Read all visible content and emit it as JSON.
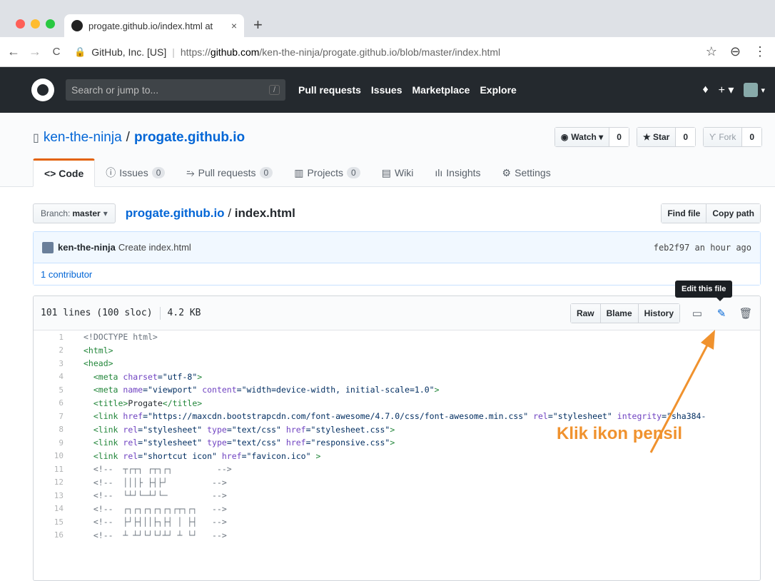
{
  "browser": {
    "tab_title": "progate.github.io/index.html at",
    "tab_close": "×",
    "new_tab": "+",
    "back": "←",
    "forward": "→",
    "reload": "C",
    "site_identity": "GitHub, Inc. [US]",
    "url_scheme": "https://",
    "url_host": "github.com",
    "url_path": "/ken-the-ninja/progate.github.io/blob/master/index.html",
    "star_icon": "☆",
    "profile_icon": "⊖",
    "menu_icon": "⋮"
  },
  "github_header": {
    "search_placeholder": "Search or jump to...",
    "search_shortcut": "/",
    "nav": [
      "Pull requests",
      "Issues",
      "Marketplace",
      "Explore"
    ],
    "bell": "🔔",
    "plus": "+ ▾",
    "avatar_caret": "▾"
  },
  "repo": {
    "owner": "ken-the-ninja",
    "separator": "/",
    "name": "progate.github.io",
    "watch_label": "Watch ▾",
    "watch_count": "0",
    "star_label": "★ Star",
    "star_count": "0",
    "fork_label": "Fork",
    "fork_count": "0",
    "tabs": {
      "code": "<> Code",
      "issues": "Issues",
      "issues_count": "0",
      "pulls": "Pull requests",
      "pulls_count": "0",
      "projects": "Projects",
      "projects_count": "0",
      "wiki": "Wiki",
      "insights": "Insights",
      "settings": "Settings"
    }
  },
  "filenav": {
    "branch_prefix": "Branch:",
    "branch": "master",
    "branch_caret": "▾",
    "repo_crumb": "progate.github.io",
    "separator": "/",
    "file": "index.html",
    "find_file": "Find file",
    "copy_path": "Copy path"
  },
  "commit": {
    "author": "ken-the-ninja",
    "message": "Create index.html",
    "sha_time": "feb2f97 an hour ago",
    "contributors": "1 contributor"
  },
  "file": {
    "lines_info": "101 lines (100 sloc)",
    "size": "4.2 KB",
    "raw": "Raw",
    "blame": "Blame",
    "history": "History",
    "tooltip": "Edit this file"
  },
  "annotation": {
    "text": "Klik ikon pensil",
    "color": "#f0922e"
  },
  "code_lines": [
    "1",
    "2",
    "3",
    "4",
    "5",
    "6",
    "7",
    "8",
    "9",
    "10",
    "11",
    "12",
    "13",
    "14",
    "15",
    "16"
  ],
  "code": {
    "l1": "<!DOCTYPE html>",
    "l2": "<html>",
    "l3": "<head>",
    "l4a": "  <meta ",
    "l4b": "charset",
    "l4c": "=\"utf-8\"",
    "l4d": ">",
    "l5a": "  <meta ",
    "l5b": "name",
    "l5c": "=\"viewport\" ",
    "l5d": "content",
    "l5e": "=\"width=device-width, initial-scale=1.0\"",
    "l5f": ">",
    "l6a": "  <title>",
    "l6b": "Progate",
    "l6c": "</title>",
    "l7a": "  <link ",
    "l7b": "href",
    "l7c": "=\"https://maxcdn.bootstrapcdn.com/font-awesome/4.7.0/css/font-awesome.min.css\" ",
    "l7d": "rel",
    "l7e": "=\"stylesheet\" ",
    "l7f": "integrity",
    "l7g": "=\"sha384-",
    "l8a": "  <link ",
    "l8b": "rel",
    "l8c": "=\"stylesheet\" ",
    "l8d": "type",
    "l8e": "=\"text/css\" ",
    "l8f": "href",
    "l8g": "=\"stylesheet.css\"",
    "l8h": ">",
    "l9a": "  <link ",
    "l9b": "rel",
    "l9c": "=\"stylesheet\" ",
    "l9d": "type",
    "l9e": "=\"text/css\" ",
    "l9f": "href",
    "l9g": "=\"responsive.css\"",
    "l9h": ">",
    "l10a": "  <link ",
    "l10b": "rel",
    "l10c": "=\"shortcut icon\" ",
    "l10d": "href",
    "l10e": "=\"favicon.ico\"",
    "l10f": " >",
    "l11": "  <!--  ┬┌┬┐ ┌┬┐┌┐         -->",
    "l12": "  <!--  │││├ ├┤├┘         -->",
    "l13": "  <!--  └┴┘└─┴┘└─         -->",
    "l14": "  <!--  ┌┐┌┐┌┐┌┐┌┐┌┬┐┌┐   -->",
    "l15": "  <!--  ├┘├┤││├┐├┤ │ ├┤   -->",
    "l16": "  <!--  ┴ ┴┘└┘└┘┴┘ ┴ └┘   -->"
  }
}
